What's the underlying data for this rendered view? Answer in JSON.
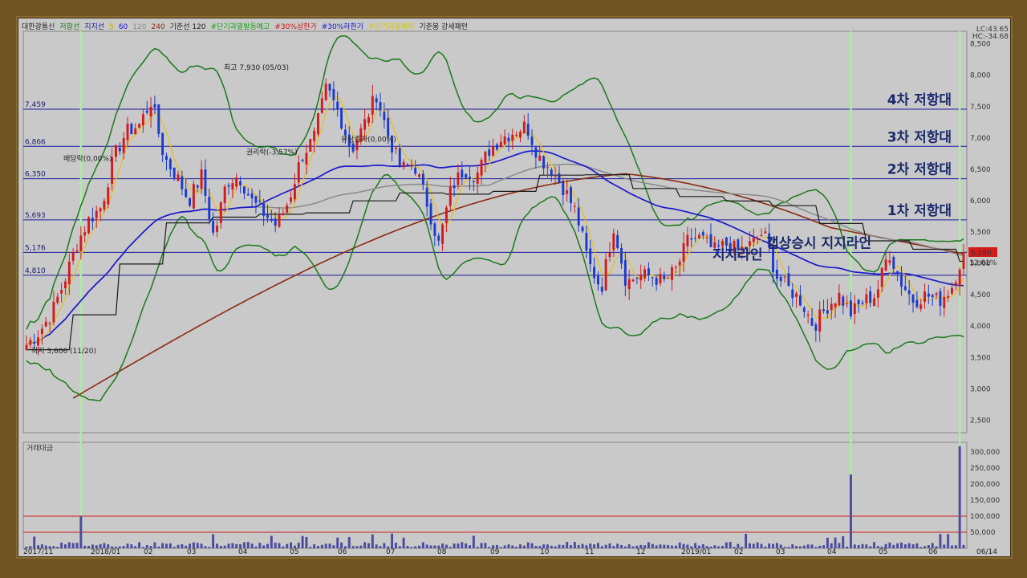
{
  "legend": [
    {
      "text": "대한광통신",
      "color": "#222222"
    },
    {
      "text": "저항선",
      "color": "#1a7a1a"
    },
    {
      "text": "지지선",
      "color": "#1a1a90"
    },
    {
      "text": "5",
      "color": "#c8a800"
    },
    {
      "text": "60",
      "color": "#1a1acc"
    },
    {
      "text": "120",
      "color": "#888888"
    },
    {
      "text": "240",
      "color": "#8b2a10"
    },
    {
      "text": "기준선 120",
      "color": "#222222"
    },
    {
      "text": "#단기과열발동예고",
      "color": "#1aa01a"
    },
    {
      "text": "#30%상한가",
      "color": "#cc1a1a"
    },
    {
      "text": "#30%하한가",
      "color": "#1a1acc"
    },
    {
      "text": "#단기과열해제",
      "color": "#d8c800"
    },
    {
      "text": "기준봉 강세패턴",
      "color": "#222222"
    }
  ],
  "readout": {
    "lc": "LC:43.65",
    "hc": "HC:-34.68"
  },
  "price_tag": {
    "value": "5,180",
    "pct": "12.61%"
  },
  "volume_panel_label": "거래대금",
  "colors": {
    "bg": "#c9c9c9",
    "level": "#1a1a9a",
    "band": "#1a7a1a",
    "ma5": "#e8c020",
    "ma60": "#1a1acc",
    "ma120": "#8a8a8a",
    "ma240": "#8b2a10",
    "base": "#1a1a1a",
    "up": "#d41a1a",
    "down": "#1a3acc",
    "marker": "#a8f0a0"
  },
  "annotations": {
    "r4": "4차 저항대",
    "r3": "3차 저항대",
    "r2": "2차 저항대",
    "r1": "1차 저항대",
    "gap": "갭상승시 지지라인",
    "support": "지지라인",
    "high": "최고 7,930 (05/03)",
    "low": "최저 3,606 (11/20)",
    "div": "배당락(0,00%)",
    "rights": "권리락(-3,57%)",
    "cap": "유상증자(0,00%)"
  },
  "chart_data": {
    "type": "candlestick",
    "title": "대한광통신",
    "ylim": [
      2300,
      8700
    ],
    "y_ticks": [
      2500,
      3000,
      3500,
      4000,
      4500,
      5000,
      5500,
      6000,
      6500,
      7000,
      7500,
      8000,
      8500
    ],
    "y_tick_labels": [
      "2,500",
      "3,000",
      "3,500",
      "4,000",
      "4,500",
      "5,000",
      "5,500",
      "6,000",
      "6,500",
      "7,000",
      "7,500",
      "8,000",
      "8,500"
    ],
    "x_labels": [
      "2017/11",
      "2018/01",
      "02",
      "03",
      "04",
      "05",
      "06",
      "07",
      "08",
      "09",
      "10",
      "11",
      "12",
      "2019/01",
      "02",
      "03",
      "04",
      "05",
      "06",
      "06/14"
    ],
    "levels": [
      {
        "value": 7459,
        "label": "7,459"
      },
      {
        "value": 6866,
        "label": "6,866"
      },
      {
        "value": 6350,
        "label": "6,350"
      },
      {
        "value": 5693,
        "label": "5,693"
      },
      {
        "value": 5176,
        "label": "5,176"
      },
      {
        "value": 4810,
        "label": "4,810"
      }
    ],
    "close_path": [
      3700,
      3900,
      4200,
      4700,
      5300,
      5700,
      5900,
      6700,
      7100,
      7200,
      7600,
      6700,
      6400,
      6000,
      6400,
      5400,
      6300,
      6400,
      6000,
      5800,
      5600,
      6000,
      6700,
      7000,
      7800,
      7400,
      6800,
      7200,
      7700,
      7000,
      6500,
      6600,
      6000,
      5300,
      6200,
      6500,
      6400,
      6800,
      7000,
      7100,
      7200,
      6700,
      6500,
      6200,
      5800,
      5000,
      4600,
      5600,
      4700,
      4800,
      4800,
      4700,
      4900,
      5400,
      5400,
      5200,
      5300,
      5200,
      5300,
      5500,
      4800,
      4600,
      4400,
      4000,
      4300,
      4500,
      4200,
      4400,
      4500,
      5200,
      4700,
      4400,
      4500,
      4400,
      4600,
      5180
    ],
    "volume_ylim": [
      0,
      330000
    ],
    "volume_ticks": [
      50000,
      100000,
      150000,
      200000,
      250000,
      300000
    ],
    "volume_tick_labels": [
      "50,000",
      "100,000",
      "150,000",
      "200,000",
      "250,000",
      "300,000"
    ],
    "volume_ref_lines": [
      50000,
      100000
    ],
    "volume_spikes": [
      {
        "index": 14,
        "value": 100000
      },
      {
        "index": 212,
        "value": 230000
      },
      {
        "index": 240,
        "value": 318000
      }
    ]
  }
}
